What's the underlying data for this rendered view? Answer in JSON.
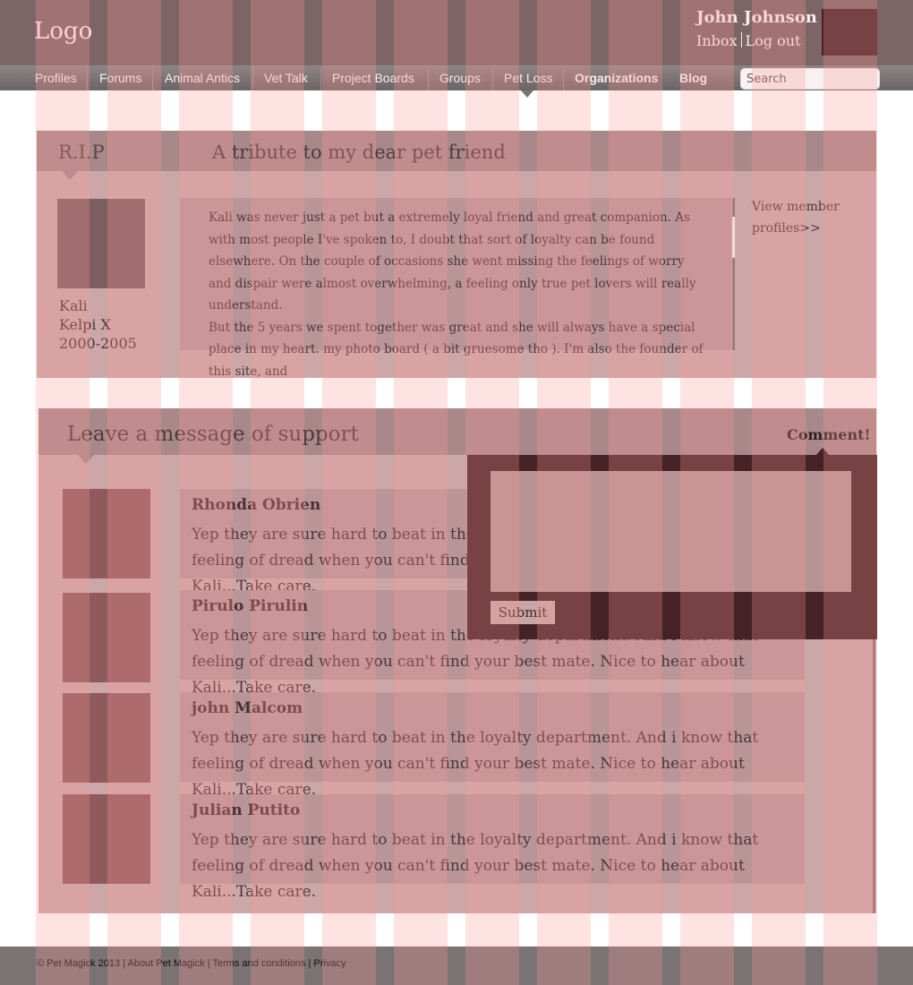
{
  "header": {
    "logo": "Logo",
    "user_name": "John Johnson",
    "inbox_label": "Inbox",
    "logout_label": "Log out"
  },
  "nav": {
    "items": [
      "Profiles",
      "Forums",
      "Animal Antics",
      "Vet Talk",
      "Project Boards",
      "Groups",
      "Pet Loss",
      "Organizations",
      "Blog"
    ],
    "active": "Pet Loss",
    "search_placeholder": "Search"
  },
  "tribute": {
    "section_label": "R.I.P",
    "title": "A tribute to my dear pet friend",
    "pet_name": "Kali",
    "pet_breed": "Kelpi X",
    "pet_years": "2000-2005",
    "paragraph_1": "Kali was never just a pet but a extremely loyal friend and great companion. As with most people I've spoken to, I doubt that sort of loyalty can be found elsewhere. On the couple of occasions she went missing the feelings of worry and dispair were almost overwhelming, a feeling only true pet lovers will really understand.",
    "paragraph_2": "But the 5 years we spent together was great and she will always have a special place in my heart. my photo board ( a bit gruesome tho ). I'm also the founder of this site, and",
    "view_profiles_link": "View member profiles>>"
  },
  "support": {
    "title": "Leave a message of support",
    "comment_link": "Comment!",
    "submit_label": "Submit",
    "comments": [
      {
        "author": "Rhonda Obrien",
        "text": "Yep they are sure hard to beat in the loyalty department. And i know that feeling of dread when you can't find your best mate. Nice to hear about Kali...Take care."
      },
      {
        "author": "Pirulo Pirulin",
        "text": "Yep they are sure hard to beat in the loyalty department. And i know that feeling of dread when you can't find your best mate. Nice to hear about Kali...Take care."
      },
      {
        "author": "john Malcom",
        "text": "Yep they are sure hard to beat in the loyalty department. And i know that feeling of dread when you can't find your best mate. Nice to hear about Kali...Take care."
      },
      {
        "author": "Julian Putito",
        "text": "Yep they are sure hard to beat in the loyalty department. And i know that feeling of dread when you can't find your best mate. Nice to hear about Kali...Take care."
      }
    ]
  },
  "footer": {
    "copyright": "© Pet Magick 2013",
    "about": "About Pet Magick",
    "terms": "Terms and conditions",
    "privacy": "Privacy"
  },
  "colors": {
    "header_bg": "#7d6566",
    "panel_bg": "#cba7a8",
    "panel_header_bg": "#a98889",
    "popup_bg": "#442226",
    "grid_overlay": "#ff9696"
  }
}
